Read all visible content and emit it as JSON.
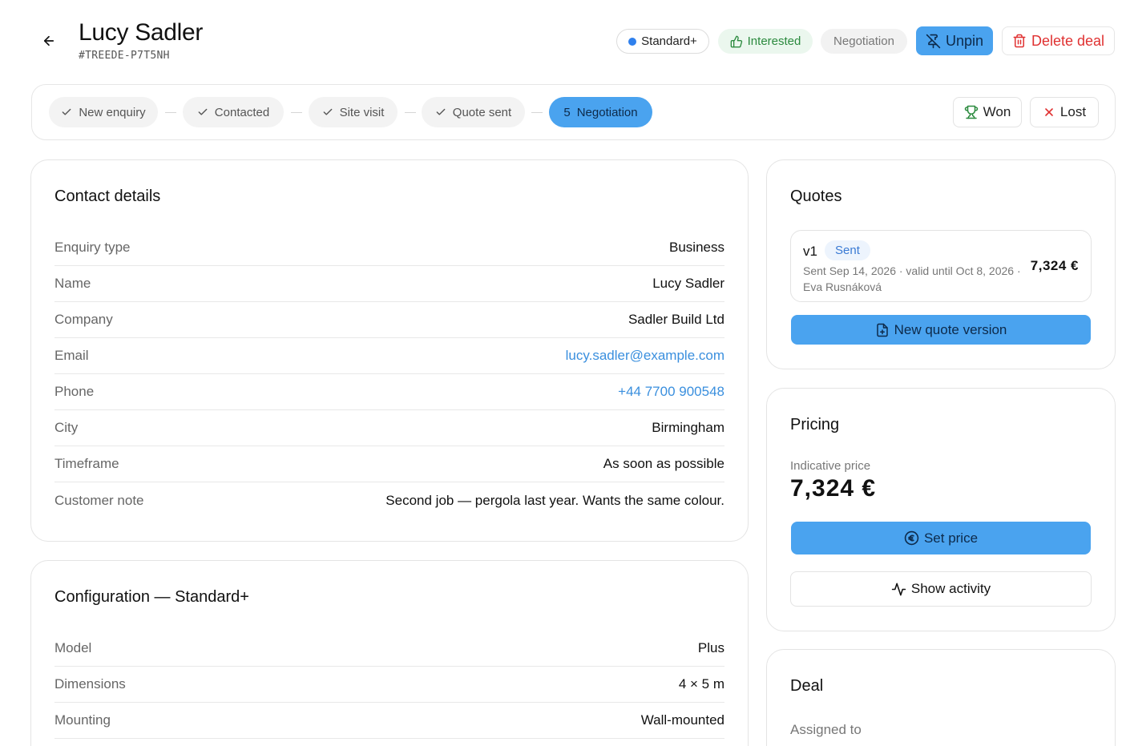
{
  "header": {
    "title": "Lucy Sadler",
    "deal_id": "#TREEDE-P7T5NH",
    "plan_chip": "Standard+",
    "interest_chip": "Interested",
    "stage_chip": "Negotiation",
    "unpin_label": "Unpin",
    "delete_label": "Delete deal"
  },
  "pipeline": {
    "steps": [
      {
        "label": "New enquiry",
        "state": "done"
      },
      {
        "label": "Contacted",
        "state": "done"
      },
      {
        "label": "Site visit",
        "state": "done"
      },
      {
        "label": "Quote sent",
        "state": "done"
      },
      {
        "number": "5",
        "label": "Negotiation",
        "state": "current"
      }
    ],
    "won_label": "Won",
    "lost_label": "Lost"
  },
  "contact": {
    "title": "Contact details",
    "rows": [
      {
        "label": "Enquiry type",
        "value": "Business"
      },
      {
        "label": "Name",
        "value": "Lucy Sadler"
      },
      {
        "label": "Company",
        "value": "Sadler Build Ltd"
      },
      {
        "label": "Email",
        "value": "lucy.sadler@example.com"
      },
      {
        "label": "Phone",
        "value": "+44 7700 900548"
      },
      {
        "label": "City",
        "value": "Birmingham"
      },
      {
        "label": "Timeframe",
        "value": "As soon as possible"
      },
      {
        "label": "Customer note",
        "value": "Second job — pergola last year. Wants the same colour."
      }
    ]
  },
  "configuration": {
    "title": "Configuration — Standard+",
    "rows": [
      {
        "label": "Model",
        "value": "Plus"
      },
      {
        "label": "Dimensions",
        "value": "4 × 5 m"
      },
      {
        "label": "Mounting",
        "value": "Wall-mounted"
      }
    ]
  },
  "quotes": {
    "title": "Quotes",
    "items": [
      {
        "version": "v1",
        "status": "Sent",
        "meta": "Sent Sep 14, 2026 · valid until Oct 8, 2026 · Eva Rusnáková",
        "amount": "7,324 €"
      }
    ],
    "new_version_label": "New quote version"
  },
  "pricing": {
    "title": "Pricing",
    "indicative_label": "Indicative price",
    "indicative_value": "7,324 €",
    "set_price_label": "Set price",
    "show_activity_label": "Show activity"
  },
  "deal": {
    "title": "Deal",
    "assigned_label": "Assigned to"
  },
  "colors": {
    "accent": "#4aa3ef",
    "link": "#3a8fde",
    "danger": "#e03131",
    "success": "#2b8a3e"
  },
  "icons": {
    "back": "arrow-left-icon",
    "plan_dot": "dot-icon",
    "interest": "thumbs-up-icon",
    "unpin": "pin-off-icon",
    "delete": "trash-icon",
    "step_done": "check-icon",
    "won": "trophy-icon",
    "lost": "x-icon",
    "new_quote": "file-plus-icon",
    "set_price": "euro-circle-icon",
    "activity": "activity-icon"
  }
}
